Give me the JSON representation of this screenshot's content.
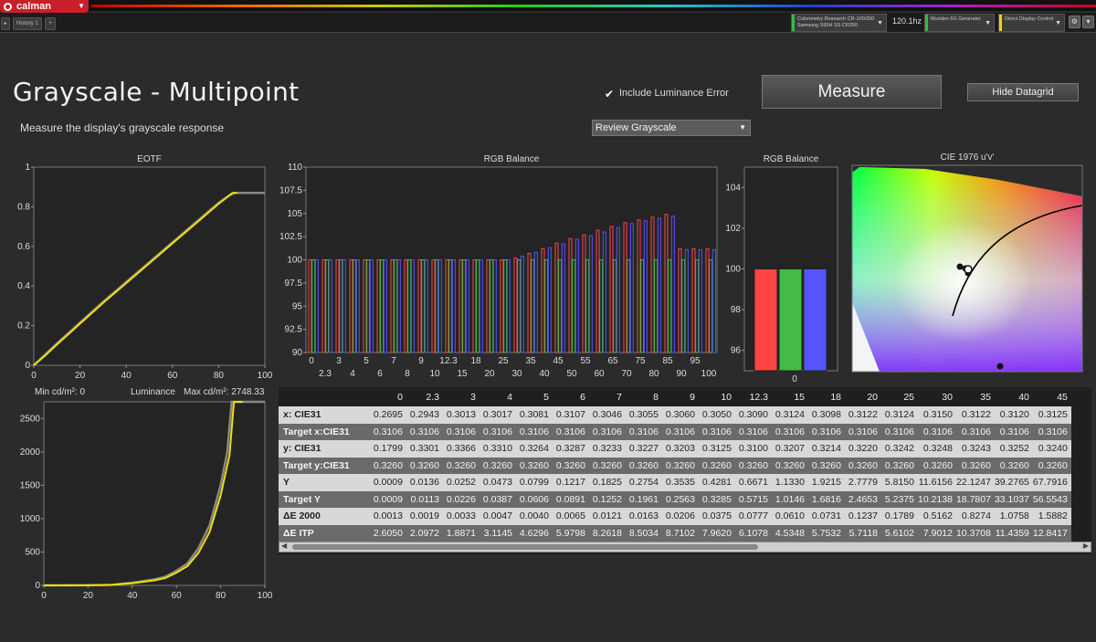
{
  "app": {
    "logo_label": "calman",
    "tab_label": "History 1",
    "devices": [
      {
        "line1": "Colorimetry Research CR-100/200",
        "line2": "Samsung S95H SS CR250",
        "color": "#2fbf3a"
      },
      {
        "line1": "Murideo 6G Generator",
        "line2": "",
        "color": "#2fbf3a"
      },
      {
        "line1": "Direct Display Control",
        "line2": "",
        "color": "#e8d400"
      }
    ],
    "refresh_rate": "120.1hz"
  },
  "header": {
    "title": "Grayscale - Multipoint",
    "subtitle": "Measure the display's grayscale response",
    "include_lum_label": "Include Luminance Error",
    "include_lum_checked": true,
    "measure_label": "Measure",
    "hide_grid_label": "Hide Datagrid",
    "review_select_value": "Review Grayscale"
  },
  "luminance_labels": {
    "min": "Min cd/m²: 0",
    "title": "Luminance",
    "max": "Max cd/m²: 2748.33"
  },
  "chart_data": [
    {
      "type": "line",
      "title": "EOTF",
      "xlim": [
        0,
        100
      ],
      "ylim": [
        0,
        1
      ],
      "xticks": [
        0,
        20,
        40,
        60,
        80,
        100
      ],
      "yticks": [
        "0",
        "0.2",
        "0.4",
        "0.6",
        "0.8",
        "1"
      ],
      "series": [
        {
          "color": "#888888",
          "x": [
            0,
            5,
            10,
            20,
            30,
            40,
            50,
            60,
            70,
            80,
            85,
            87,
            100
          ],
          "y": [
            0,
            0.055,
            0.11,
            0.215,
            0.32,
            0.42,
            0.52,
            0.62,
            0.72,
            0.82,
            0.86,
            0.87,
            0.87
          ]
        },
        {
          "color": "#f0e000",
          "x": [
            0,
            5,
            10,
            20,
            30,
            40,
            50,
            60,
            70,
            80,
            86,
            88
          ],
          "y": [
            0,
            0.05,
            0.105,
            0.21,
            0.315,
            0.415,
            0.515,
            0.615,
            0.715,
            0.815,
            0.87,
            0.87
          ]
        }
      ]
    },
    {
      "type": "bar",
      "title": "RGB Balance",
      "ylim": [
        90,
        110
      ],
      "yticks": [
        "90",
        "92.5",
        "95",
        "97.5",
        "100",
        "102.5",
        "105",
        "107.5",
        "110"
      ],
      "xticks_top": [
        "0",
        "3",
        "5",
        "7",
        "9",
        "12.3",
        "18",
        "25",
        "35",
        "45",
        "55",
        "65",
        "75",
        "85",
        "95"
      ],
      "xticks_bottom": [
        "2.3",
        "4",
        "6",
        "8",
        "10",
        "15",
        "20",
        "30",
        "40",
        "50",
        "60",
        "70",
        "80",
        "90",
        "100"
      ],
      "categories": [
        "0",
        "2.3",
        "3",
        "4",
        "5",
        "6",
        "7",
        "8",
        "9",
        "10",
        "12.3",
        "15",
        "18",
        "20",
        "25",
        "30",
        "35",
        "40",
        "45",
        "50",
        "55",
        "60",
        "65",
        "70",
        "75",
        "80",
        "85",
        "90",
        "95",
        "100"
      ],
      "series": [
        {
          "color": "#ff4444",
          "values": [
            100,
            100,
            100,
            100,
            100,
            100,
            100,
            100,
            100,
            100,
            100,
            100,
            100,
            100,
            100,
            100.2,
            100.7,
            101.2,
            101.8,
            102.3,
            102.7,
            103.2,
            103.6,
            104.0,
            104.3,
            104.6,
            104.9,
            101.2,
            101.2,
            101.2
          ]
        },
        {
          "color": "#44bb44",
          "values": [
            100,
            100,
            100,
            100,
            100,
            100,
            100,
            100,
            100,
            100,
            100,
            100,
            100,
            100,
            100,
            100,
            100,
            100,
            100,
            100,
            100,
            100,
            100,
            100,
            100,
            100,
            100,
            100,
            100,
            100
          ]
        },
        {
          "color": "#5555ff",
          "values": [
            100,
            100,
            100,
            100,
            100,
            100,
            100,
            100,
            100,
            100,
            100,
            100,
            100,
            100,
            100,
            100.4,
            100.8,
            101.3,
            101.7,
            102.2,
            102.6,
            103.0,
            103.5,
            103.9,
            104.2,
            104.5,
            104.7,
            101.1,
            101.1,
            101.1
          ]
        }
      ]
    },
    {
      "type": "bar",
      "title": "RGB Balance",
      "ylim": [
        95,
        105
      ],
      "yticks": [
        "96",
        "98",
        "100",
        "102",
        "104"
      ],
      "categories": [
        "0"
      ],
      "series": [
        {
          "color": "#ff4444",
          "values": [
            100
          ]
        },
        {
          "color": "#44bb44",
          "values": [
            100
          ]
        },
        {
          "color": "#5555ff",
          "values": [
            100
          ]
        }
      ]
    },
    {
      "type": "scatter",
      "title": "CIE 1976 u'v'"
    },
    {
      "type": "line",
      "title": "Luminance",
      "xlim": [
        0,
        100
      ],
      "ylim": [
        0,
        2750
      ],
      "xticks": [
        0,
        20,
        40,
        60,
        80,
        100
      ],
      "yticks": [
        "0",
        "500",
        "1000",
        "1500",
        "2000",
        "2500"
      ],
      "series": [
        {
          "color": "#888888",
          "x": [
            0,
            20,
            30,
            40,
            50,
            55,
            60,
            65,
            70,
            75,
            80,
            83,
            85,
            90,
            100
          ],
          "y": [
            0,
            2,
            6,
            39,
            90,
            130,
            220,
            330,
            560,
            900,
            1500,
            2000,
            2750,
            2750,
            2750
          ]
        },
        {
          "color": "#f0e000",
          "x": [
            0,
            20,
            30,
            40,
            50,
            55,
            60,
            65,
            70,
            75,
            80,
            84,
            86,
            90
          ],
          "y": [
            0,
            2,
            6,
            33,
            75,
            110,
            190,
            290,
            490,
            800,
            1350,
            1950,
            2748,
            2748
          ]
        }
      ]
    }
  ],
  "datagrid": {
    "columns": [
      "0",
      "2.3",
      "3",
      "4",
      "5",
      "6",
      "7",
      "8",
      "9",
      "10",
      "12.3",
      "15",
      "18",
      "20",
      "25",
      "30",
      "35",
      "40",
      "45"
    ],
    "rows": [
      {
        "label": "x: CIE31",
        "values": [
          "0.2695",
          "0.2943",
          "0.3013",
          "0.3017",
          "0.3081",
          "0.3107",
          "0.3046",
          "0.3055",
          "0.3060",
          "0.3050",
          "0.3090",
          "0.3124",
          "0.3098",
          "0.3122",
          "0.3124",
          "0.3150",
          "0.3122",
          "0.3120",
          "0.3125"
        ]
      },
      {
        "label": "Target x:CIE31",
        "values": [
          "0.3106",
          "0.3106",
          "0.3106",
          "0.3106",
          "0.3106",
          "0.3106",
          "0.3106",
          "0.3106",
          "0.3106",
          "0.3106",
          "0.3106",
          "0.3106",
          "0.3106",
          "0.3106",
          "0.3106",
          "0.3106",
          "0.3106",
          "0.3106",
          "0.3106"
        ]
      },
      {
        "label": "y: CIE31",
        "values": [
          "0.1799",
          "0.3301",
          "0.3366",
          "0.3310",
          "0.3264",
          "0.3287",
          "0.3233",
          "0.3227",
          "0.3203",
          "0.3125",
          "0.3100",
          "0.3207",
          "0.3214",
          "0.3220",
          "0.3242",
          "0.3248",
          "0.3243",
          "0.3252",
          "0.3240"
        ]
      },
      {
        "label": "Target y:CIE31",
        "values": [
          "0.3260",
          "0.3260",
          "0.3260",
          "0.3260",
          "0.3260",
          "0.3260",
          "0.3260",
          "0.3260",
          "0.3260",
          "0.3260",
          "0.3260",
          "0.3260",
          "0.3260",
          "0.3260",
          "0.3260",
          "0.3260",
          "0.3260",
          "0.3260",
          "0.3260"
        ]
      },
      {
        "label": "Y",
        "values": [
          "0.0009",
          "0.0136",
          "0.0252",
          "0.0473",
          "0.0799",
          "0.1217",
          "0.1825",
          "0.2754",
          "0.3535",
          "0.4281",
          "0.6671",
          "1.1330",
          "1.9215",
          "2.7779",
          "5.8150",
          "11.6156",
          "22.1247",
          "39.2765",
          "67.7916"
        ]
      },
      {
        "label": "Target Y",
        "values": [
          "0.0009",
          "0.0113",
          "0.0226",
          "0.0387",
          "0.0606",
          "0.0891",
          "0.1252",
          "0.1961",
          "0.2563",
          "0.3285",
          "0.5715",
          "1.0146",
          "1.6816",
          "2.4653",
          "5.2375",
          "10.2138",
          "18.7807",
          "33.1037",
          "56.5543"
        ]
      },
      {
        "label": "ΔE 2000",
        "values": [
          "0.0013",
          "0.0019",
          "0.0033",
          "0.0047",
          "0.0040",
          "0.0065",
          "0.0121",
          "0.0163",
          "0.0206",
          "0.0375",
          "0.0777",
          "0.0610",
          "0.0731",
          "0.1237",
          "0.1789",
          "0.5162",
          "0.8274",
          "1.0758",
          "1.5882"
        ]
      },
      {
        "label": "ΔE ITP",
        "values": [
          "2.6050",
          "2.0972",
          "1.8871",
          "3.1145",
          "4.6296",
          "5.9798",
          "8.2618",
          "8.5034",
          "8.7102",
          "7.9620",
          "6.1078",
          "4.5348",
          "5.7532",
          "5.7118",
          "5.6102",
          "7.9012",
          "10.3708",
          "11.4359",
          "12.8417"
        ]
      }
    ]
  }
}
